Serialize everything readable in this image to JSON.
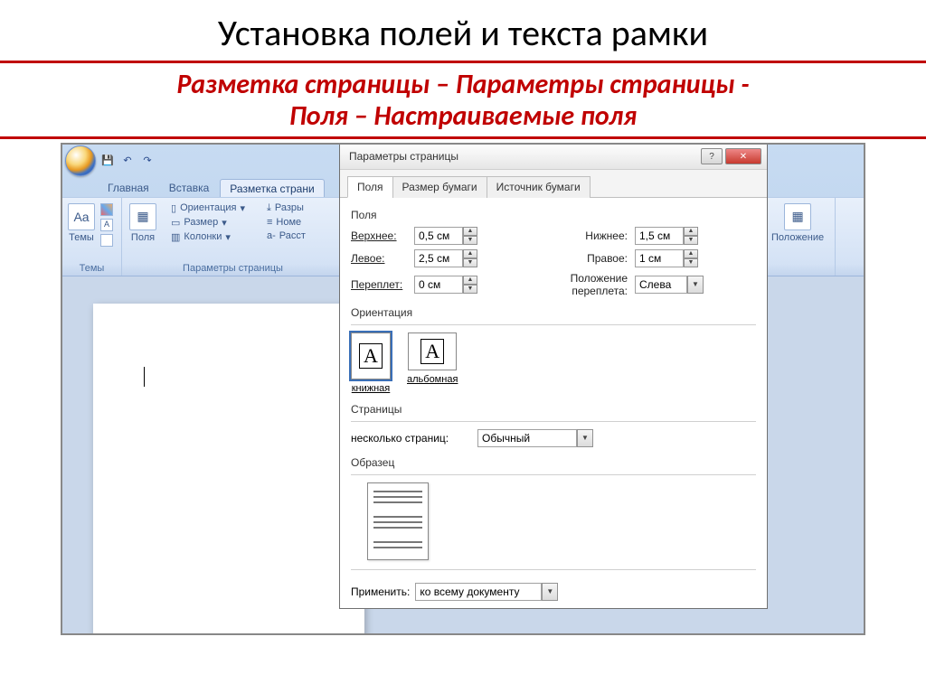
{
  "slide": {
    "title": "Установка полей и текста рамки",
    "subtitle_line1": "Разметка страницы – Параметры страницы -",
    "subtitle_line2": "Поля – Настраиваемые поля"
  },
  "word": {
    "tabs": {
      "home": "Главная",
      "insert": "Вставка",
      "layout": "Разметка страни"
    },
    "ribbon": {
      "themes_group": "Темы",
      "themes_btn": "Темы",
      "page_params_group": "Параметры страницы",
      "margins_btn": "Поля",
      "orientation": "Ориентация",
      "size": "Размер",
      "columns": "Колонки",
      "breaks": "Разры",
      "line_numbers": "Номе",
      "hyphenation": "Расст",
      "position": "Положение"
    },
    "qat": {
      "save": "💾",
      "undo": "↶",
      "redo": "↷"
    }
  },
  "dialog": {
    "title": "Параметры страницы",
    "help": "?",
    "close": "✕",
    "tabs": {
      "fields": "Поля",
      "paper": "Размер бумаги",
      "source": "Источник бумаги"
    },
    "section_fields": "Поля",
    "top_label": "Верхнее:",
    "top_value": "0,5 см",
    "bottom_label": "Нижнее:",
    "bottom_value": "1,5 см",
    "left_label": "Левое:",
    "left_value": "2,5 см",
    "right_label": "Правое:",
    "right_value": "1 см",
    "gutter_label": "Переплет:",
    "gutter_value": "0 см",
    "gutter_pos_label": "Положение переплета:",
    "gutter_pos_value": "Слева",
    "section_orientation": "Ориентация",
    "portrait": "книжная",
    "landscape": "альбомная",
    "glyph": "A",
    "section_pages": "Страницы",
    "multi_pages_label": "несколько страниц:",
    "multi_pages_value": "Обычный",
    "section_preview": "Образец",
    "apply_label": "Применить:",
    "apply_value": "ко всему документу"
  }
}
